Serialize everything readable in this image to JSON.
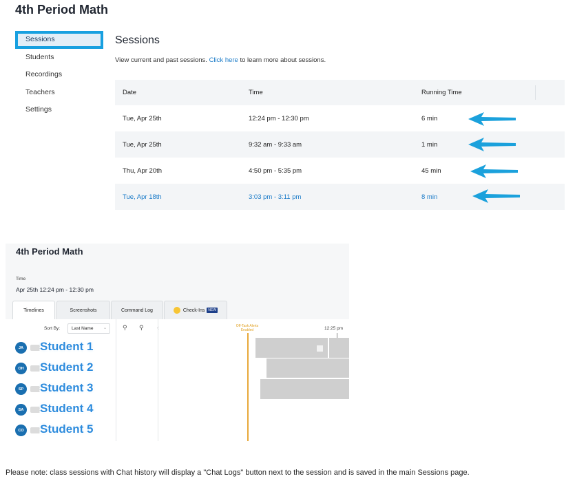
{
  "top": {
    "title": "4th Period Math",
    "sidebar": [
      "Sessions",
      "Students",
      "Recordings",
      "Teachers",
      "Settings"
    ],
    "main_title": "Sessions",
    "desc_before": "View current and past sessions. ",
    "desc_link": "Click here",
    "desc_after": " to learn more about sessions.",
    "table": {
      "headers": [
        "Date",
        "Time",
        "Running Time"
      ],
      "rows": [
        {
          "date": "Tue, Apr 25th",
          "time": "12:24 pm - 12:30 pm",
          "running": "6 min"
        },
        {
          "date": "Tue, Apr 25th",
          "time": "9:32 am - 9:33 am",
          "running": "1 min"
        },
        {
          "date": "Thu, Apr 20th",
          "time": "4:50 pm - 5:35 pm",
          "running": "45 min"
        },
        {
          "date": "Tue, Apr 18th",
          "time": "3:03 pm - 3:11 pm",
          "running": "8 min"
        }
      ]
    }
  },
  "shot": {
    "title": "4th Period Math",
    "time_label": "Time",
    "time_value": "Apr 25th 12:24 pm - 12:30 pm",
    "tabs": [
      "Timelines",
      "Screenshots",
      "Command Log",
      "Check-Ins"
    ],
    "new_badge": "NEW",
    "sort_label": "Sort By:",
    "sort_value": "Last Name",
    "alert_label": "Off-Task Alerts Enabled",
    "time_tick": "12:25 pm",
    "students": [
      {
        "initials": "JA",
        "name": "Student 1"
      },
      {
        "initials": "OH",
        "name": "Student 2"
      },
      {
        "initials": "SP",
        "name": "Student 3"
      },
      {
        "initials": "SA",
        "name": "Student 4"
      },
      {
        "initials": "CO",
        "name": "Student 5"
      }
    ]
  },
  "note": "Please note: class sessions with Chat history will display a \"Chat Logs\" button next to the session and is saved in the main Sessions page.",
  "colors": {
    "accent": "#18a0e0",
    "link": "#1a7bc8",
    "arrow": "#1ba1dc",
    "alert": "#e8a93a"
  }
}
